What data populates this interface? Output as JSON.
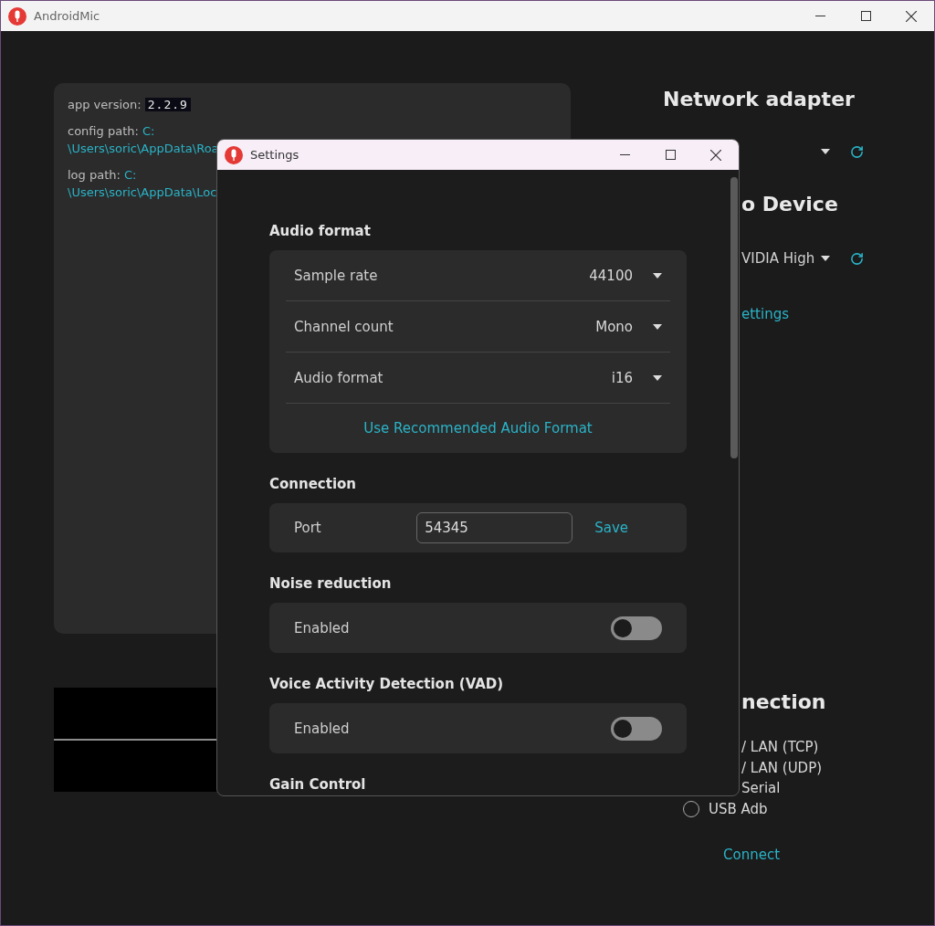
{
  "window": {
    "title": "AndroidMic"
  },
  "info_panel": {
    "items": [
      {
        "kind": "code",
        "label": "app version:",
        "value_lines": [
          "2.2.9"
        ]
      },
      {
        "kind": "path",
        "label": "config path:",
        "value_lines": [
          "C:",
          "\\Users\\soric\\AppData\\Roa"
        ]
      },
      {
        "kind": "path",
        "label": "log path:",
        "value_lines": [
          "C:",
          "\\Users\\soric\\AppData\\Loc"
        ]
      }
    ]
  },
  "network_adapter": {
    "heading": "Network adapter"
  },
  "audio_device": {
    "heading": "o Device",
    "value": "VIDIA High",
    "link": "ettings"
  },
  "connection": {
    "heading": "nection",
    "modes": [
      {
        "label": "/ LAN (TCP)"
      },
      {
        "label": "/ LAN (UDP)"
      },
      {
        "label": "Serial"
      },
      {
        "label": "USB Adb",
        "selected": false
      }
    ],
    "button": "Connect"
  },
  "settings_dialog": {
    "title": "Settings",
    "sections": [
      {
        "kind": "dropdowns",
        "heading": "Audio format",
        "rows": [
          {
            "label": "Sample rate",
            "value": "44100"
          },
          {
            "label": "Channel count",
            "value": "Mono"
          },
          {
            "label": "Audio format",
            "value": "i16"
          }
        ],
        "link": "Use Recommended Audio Format"
      },
      {
        "kind": "port",
        "heading": "Connection",
        "label": "Port",
        "value": "54345",
        "button": "Save"
      },
      {
        "kind": "toggle",
        "heading": "Noise reduction",
        "label": "Enabled",
        "on": false
      },
      {
        "kind": "toggle",
        "heading": "Voice Activity Detection (VAD)",
        "label": "Enabled",
        "on": false
      },
      {
        "kind": "heading",
        "heading": "Gain Control"
      }
    ]
  }
}
